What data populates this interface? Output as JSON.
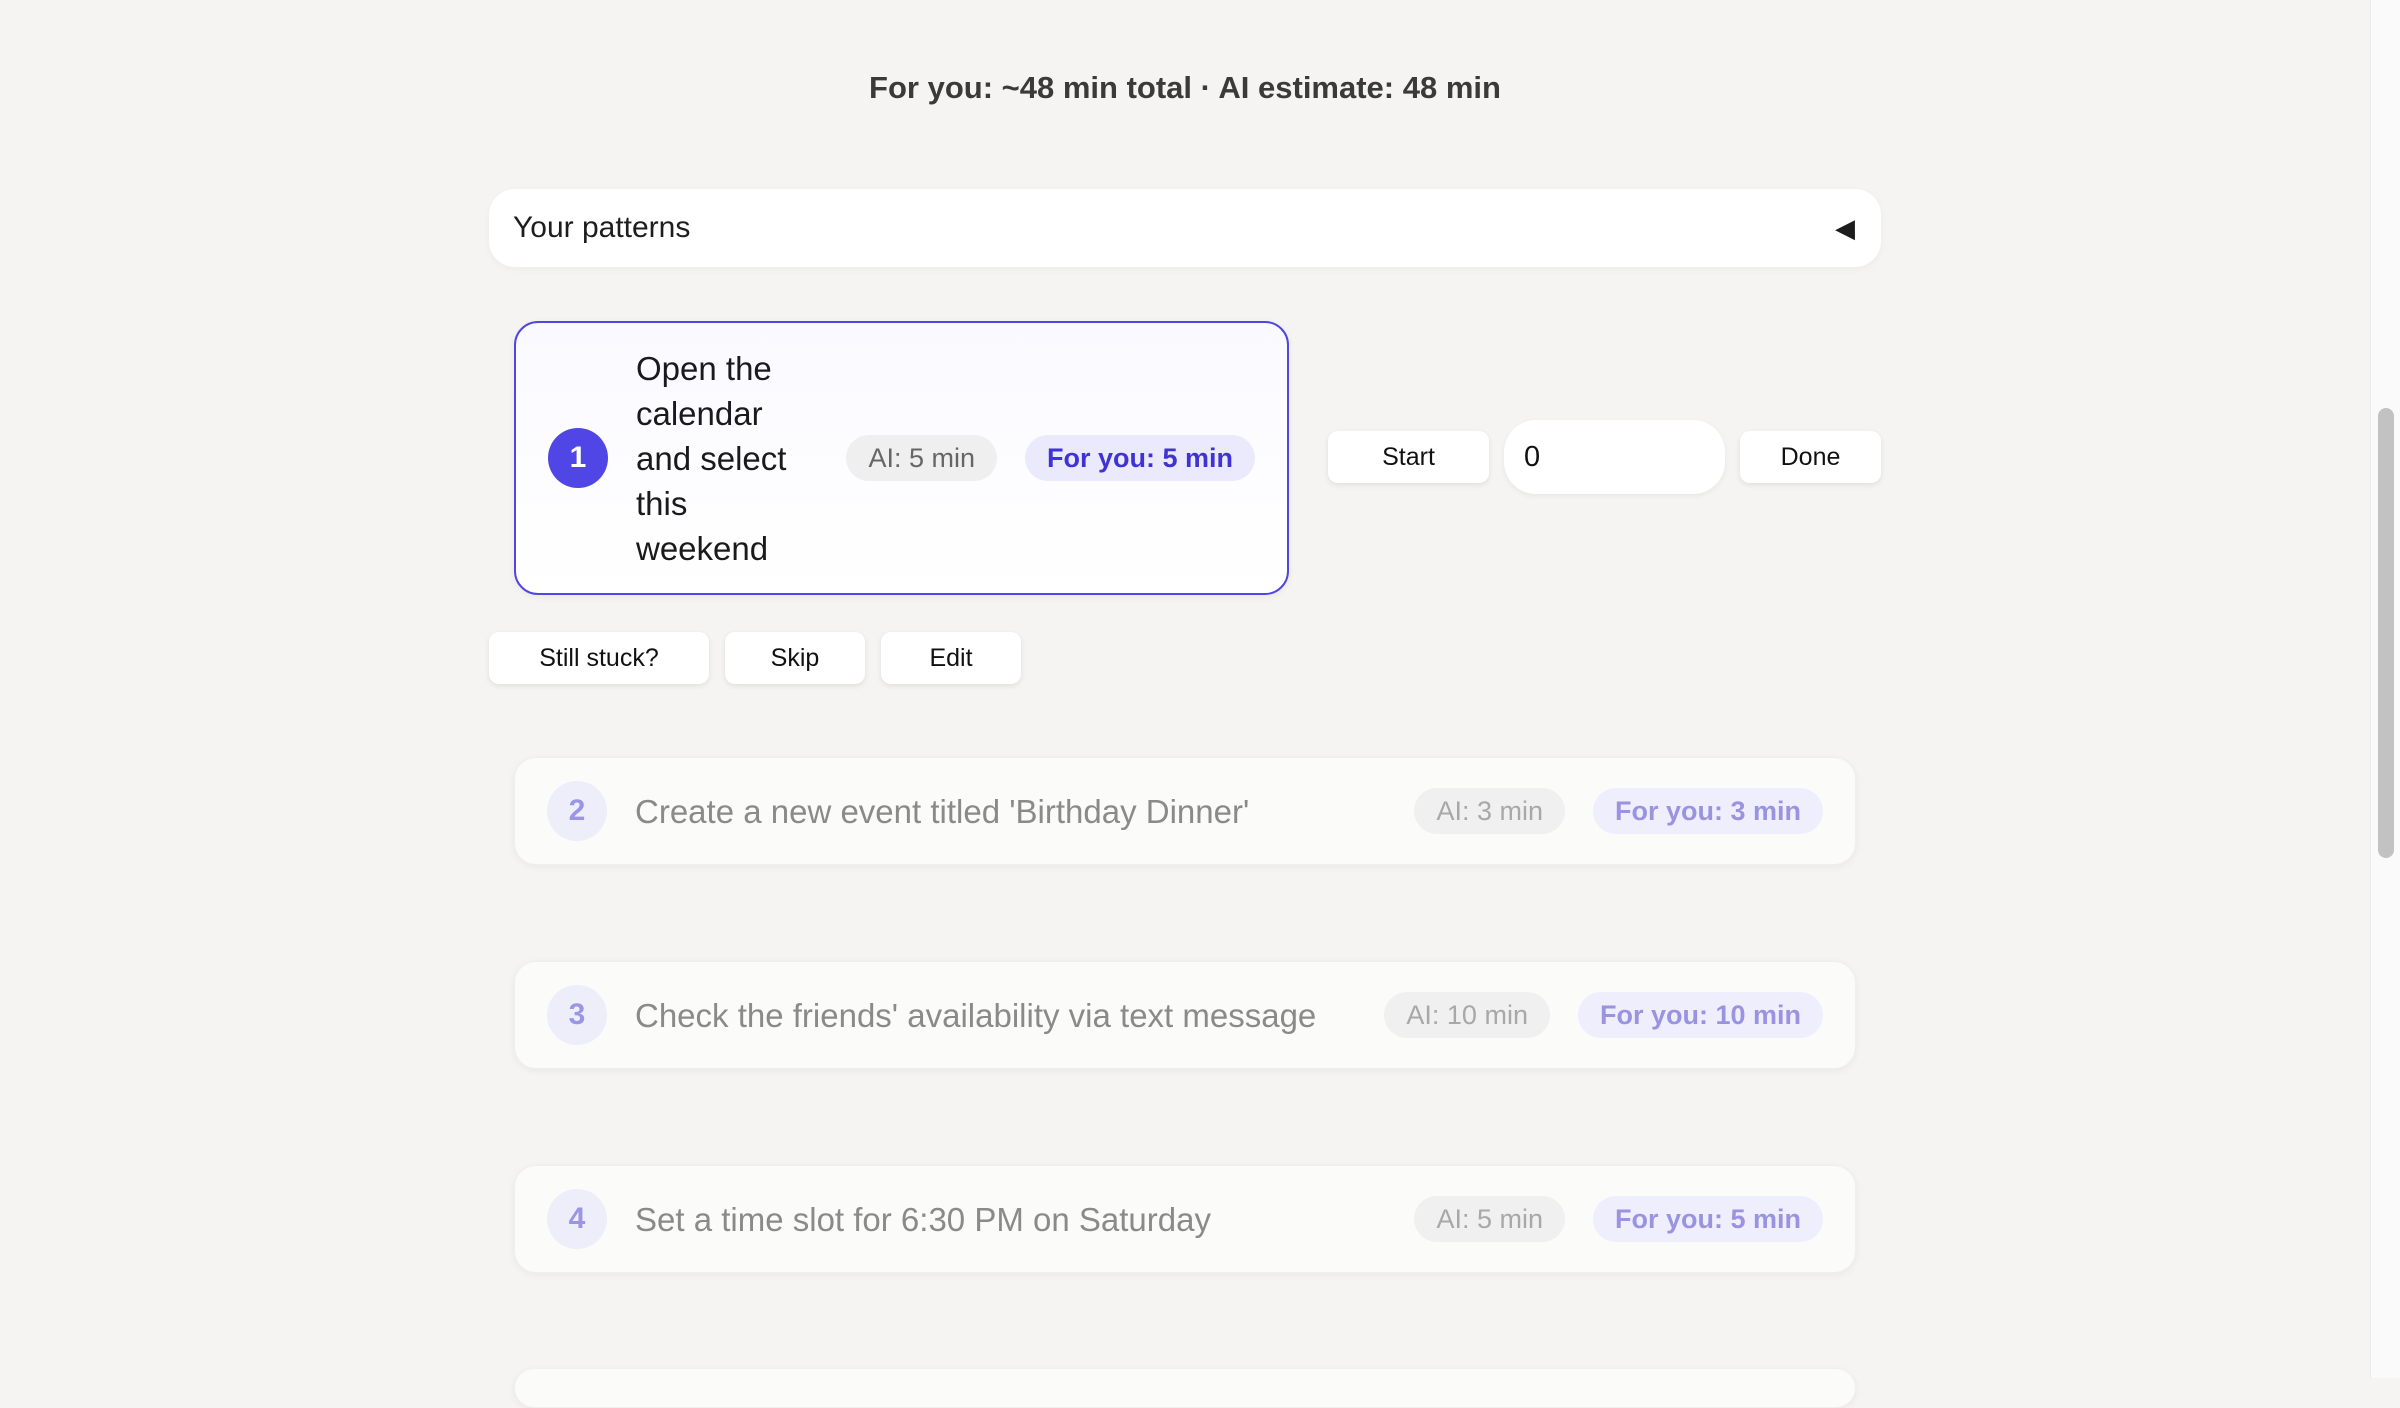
{
  "summary": "For you: ~48 min total · AI estimate: 48 min",
  "patterns": {
    "label": "Your patterns",
    "toggle": "◀"
  },
  "active_task": {
    "number": "1",
    "title": "Open the calendar and select this weekend",
    "ai": "AI: 5 min",
    "you": "For you: 5 min",
    "start_label": "Start",
    "timer_value": "0",
    "done_label": "Done",
    "stuck_label": "Still stuck?",
    "skip_label": "Skip",
    "edit_label": "Edit"
  },
  "tasks": [
    {
      "number": "2",
      "title": "Create a new event titled 'Birthday Dinner'",
      "ai": "AI: 3 min",
      "you": "For you: 3 min"
    },
    {
      "number": "3",
      "title": "Check the friends' availability via text message",
      "ai": "AI: 10 min",
      "you": "For you: 10 min"
    },
    {
      "number": "4",
      "title": "Set a time slot for 6:30 PM on Saturday",
      "ai": "AI: 5 min",
      "you": "For you: 5 min"
    }
  ],
  "colors": {
    "accent": "#4f46e5",
    "background": "#f5f4f2"
  }
}
